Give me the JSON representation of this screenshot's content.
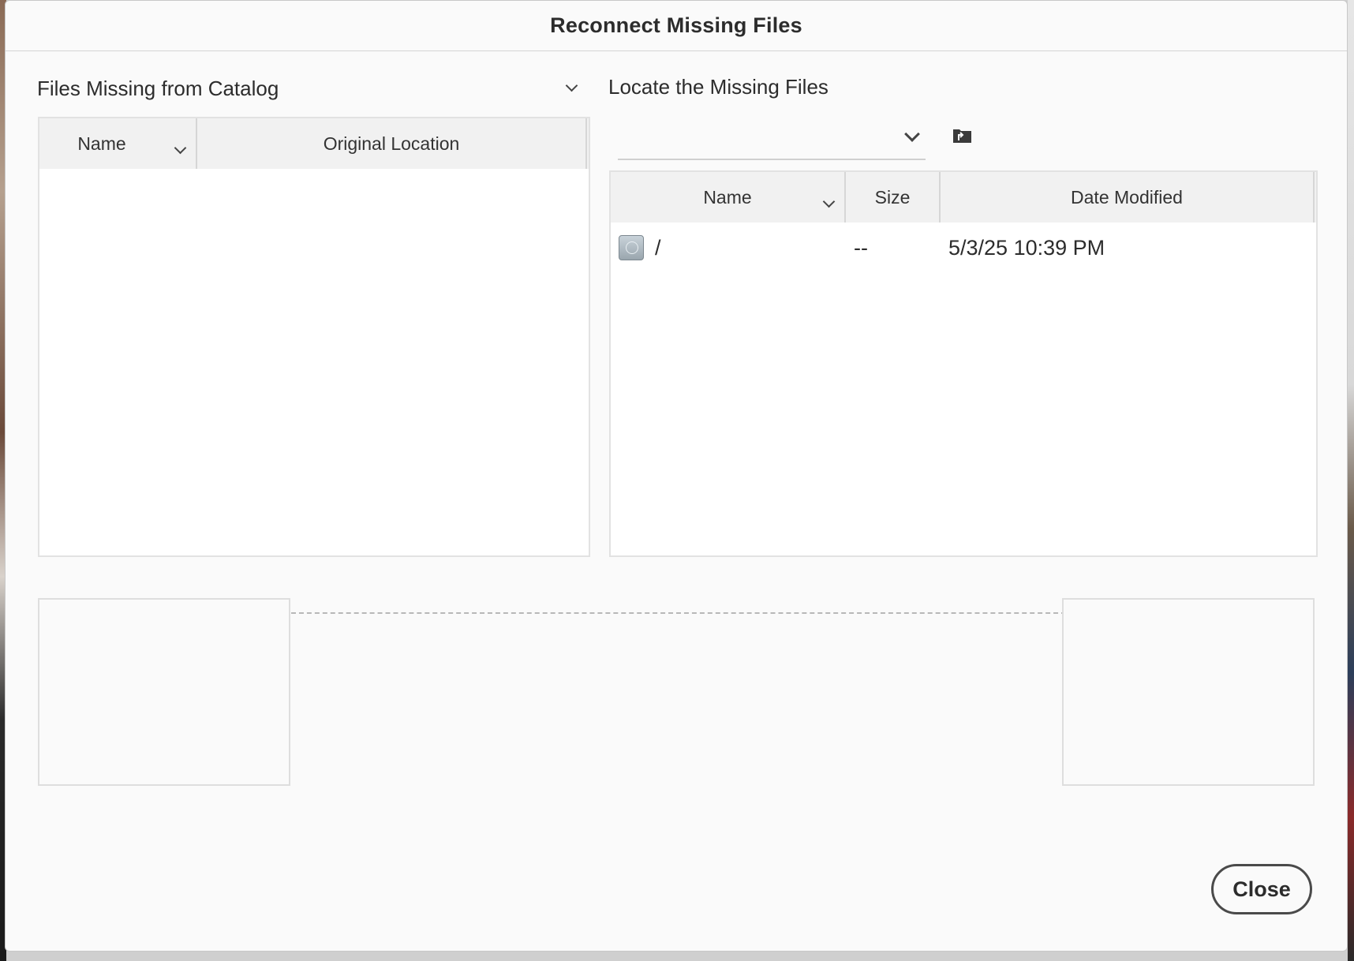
{
  "dialog": {
    "title": "Reconnect Missing Files"
  },
  "left_panel": {
    "heading": "Files Missing from Catalog",
    "columns": {
      "name": "Name",
      "original_location": "Original Location"
    },
    "rows": []
  },
  "right_panel": {
    "heading": "Locate the Missing Files",
    "path_dropdown_value": "",
    "columns": {
      "name": "Name",
      "size": "Size",
      "date_modified": "Date Modified"
    },
    "rows": [
      {
        "icon": "hard-disk-icon",
        "name": "/",
        "size": "--",
        "date_modified": "5/3/25 10:39 PM"
      }
    ]
  },
  "footer": {
    "close_label": "Close"
  }
}
